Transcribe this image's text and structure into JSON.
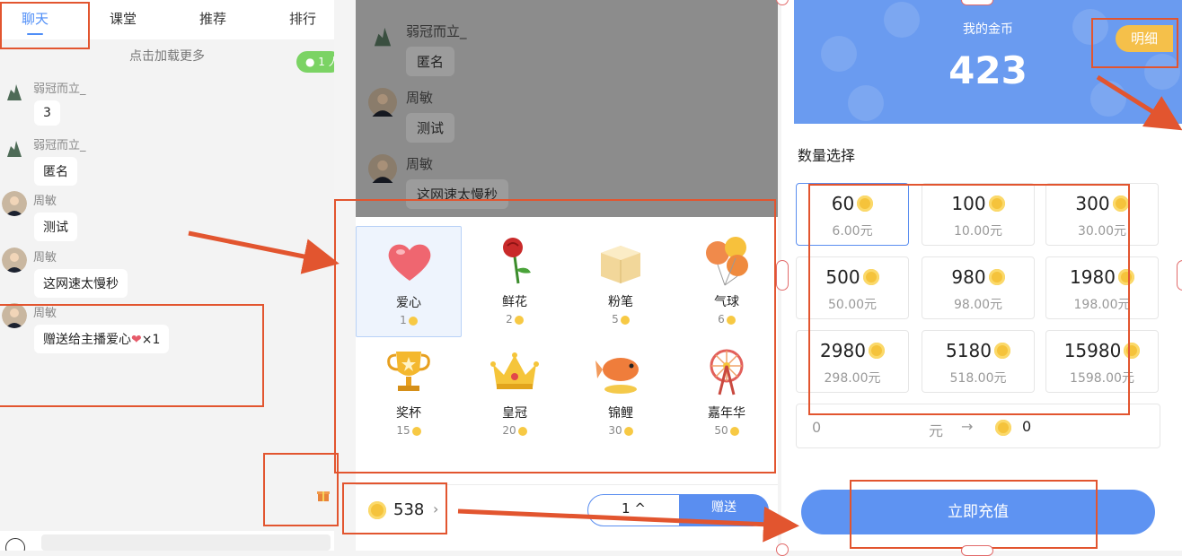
{
  "chat": {
    "tabs": [
      "聊天",
      "课堂",
      "推荐",
      "排行"
    ],
    "load_more": "点击加载更多",
    "online_count": "1",
    "messages": [
      {
        "name": "弱冠而立_",
        "text": "3"
      },
      {
        "name": "弱冠而立_",
        "text": "匿名"
      },
      {
        "name": "周敏",
        "text": "测试"
      },
      {
        "name": "周敏",
        "text": "这网速太慢秒"
      },
      {
        "name": "周敏",
        "text": "赠送给主播爱心",
        "suffix": "×1"
      }
    ]
  },
  "gift_panel": {
    "bg_messages": [
      {
        "name": "弱冠而立_",
        "text": "匿名"
      },
      {
        "name": "周敏",
        "text": "测试"
      },
      {
        "name": "周敏",
        "text": "这网速太慢秒"
      }
    ],
    "gifts": [
      {
        "name": "爱心",
        "price": "1",
        "icon": "heart-icon"
      },
      {
        "name": "鲜花",
        "price": "2",
        "icon": "rose-icon"
      },
      {
        "name": "粉笔",
        "price": "5",
        "icon": "chalk-box-icon"
      },
      {
        "name": "气球",
        "price": "6",
        "icon": "balloons-icon"
      },
      {
        "name": "奖杯",
        "price": "15",
        "icon": "trophy-icon"
      },
      {
        "name": "皇冠",
        "price": "20",
        "icon": "crown-icon"
      },
      {
        "name": "锦鲤",
        "price": "30",
        "icon": "koi-icon"
      },
      {
        "name": "嘉年华",
        "price": "50",
        "icon": "ferris-wheel-icon"
      }
    ],
    "balance": "538",
    "quantity": "1",
    "send_label": "赠送"
  },
  "recharge": {
    "title": "我的金币",
    "coins": "423",
    "detail_label": "明细",
    "section_label": "数量选择",
    "options": [
      {
        "coins": "60",
        "price": "6.00元"
      },
      {
        "coins": "100",
        "price": "10.00元"
      },
      {
        "coins": "300",
        "price": "30.00元"
      },
      {
        "coins": "500",
        "price": "50.00元"
      },
      {
        "coins": "980",
        "price": "98.00元"
      },
      {
        "coins": "1980",
        "price": "198.00元"
      },
      {
        "coins": "2980",
        "price": "298.00元"
      },
      {
        "coins": "5180",
        "price": "518.00元"
      },
      {
        "coins": "15980",
        "price": "1598.00元"
      }
    ],
    "custom_amount": "0",
    "custom_unit": "元",
    "custom_arrow": "→",
    "custom_result": "0",
    "recharge_label": "立即充值"
  },
  "colors": {
    "accent": "#5a8ef0",
    "annotation": "#e2552f",
    "coin": "#f5c33b",
    "header": "#6a9bf0"
  }
}
